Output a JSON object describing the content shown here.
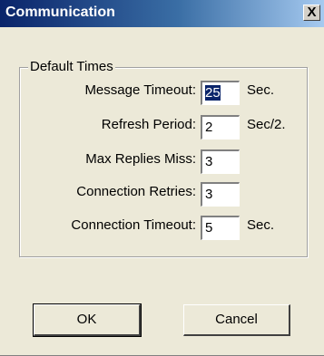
{
  "window": {
    "title": "Communication",
    "close_glyph": "X"
  },
  "group": {
    "legend": "Default Times"
  },
  "fields": [
    {
      "label": "Message Timeout:",
      "value": "25",
      "unit": "Sec.",
      "selected": true
    },
    {
      "label": "Refresh Period:",
      "value": "2",
      "unit": "Sec/2."
    },
    {
      "label": "Max Replies Miss:",
      "value": "3",
      "unit": ""
    },
    {
      "label": "Connection Retries:",
      "value": "3",
      "unit": ""
    },
    {
      "label": "Connection Timeout:",
      "value": "5",
      "unit": "Sec."
    }
  ],
  "buttons": {
    "ok": "OK",
    "cancel": "Cancel"
  }
}
